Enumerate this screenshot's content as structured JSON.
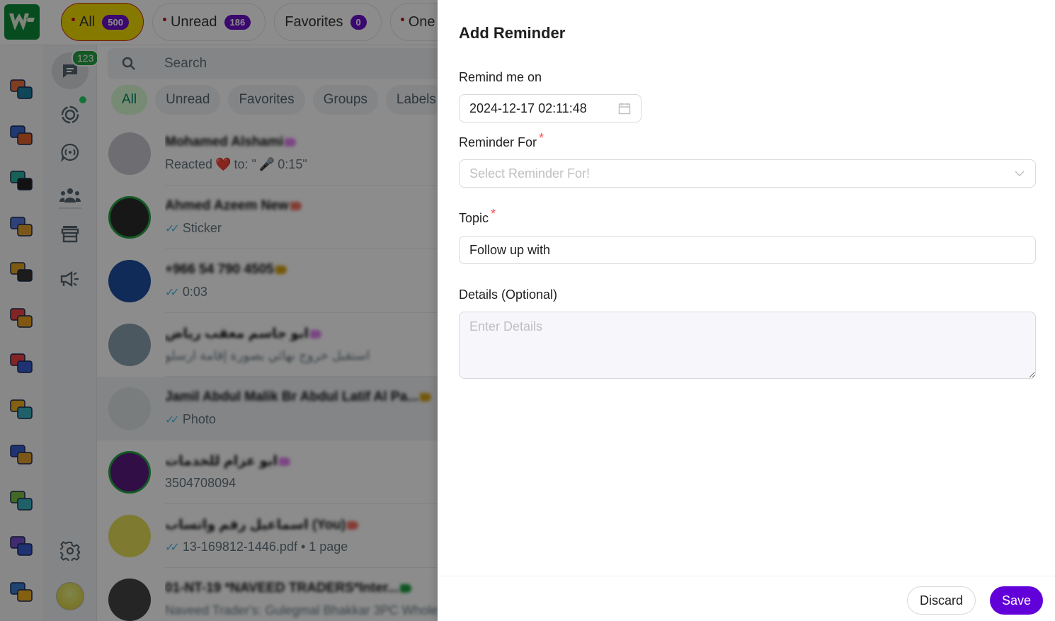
{
  "app": {
    "logo_text": "W",
    "top_tabs": [
      {
        "label": "All",
        "count": "500",
        "dot": true,
        "active": true
      },
      {
        "label": "Unread",
        "count": "186",
        "dot": true,
        "active": false
      },
      {
        "label": "Favorites",
        "count": "0",
        "dot": false,
        "active": false
      },
      {
        "label": "One to",
        "count": "",
        "dot": true,
        "active": false
      }
    ],
    "rail1_icons": [
      "chat-bubbles-icon",
      "templates-icon",
      "multi-chat-icon",
      "chatbot-icon",
      "board-icon",
      "notification-chat-icon",
      "todo-icon",
      "reminder-bell-icon",
      "schedule-table-icon",
      "widget-touch-icon",
      "settings-tool-icon",
      "support-agent-icon"
    ],
    "rail2": {
      "chats_badge": "123",
      "icons": [
        "chats-icon",
        "status-icon",
        "channels-icon",
        "communities-icon",
        "store-icon",
        "broadcast-icon",
        "settings-icon"
      ]
    },
    "search": {
      "placeholder": "Search"
    },
    "filter_chips": [
      "All",
      "Unread",
      "Favorites",
      "Groups",
      "Labels"
    ],
    "chats": [
      {
        "name": "Mohamed Alshami",
        "preview_parts": [
          "Reacted",
          "❤️",
          "to: \"",
          "🎤",
          "0:15\""
        ],
        "tag_color": "#e07ef0",
        "ring": false,
        "ticks": false
      },
      {
        "name": "Ahmed Azeem New",
        "preview": "Sticker",
        "tag_color": "#f07060",
        "ring": true,
        "ticks": true
      },
      {
        "name": "+966 54 790 4505",
        "preview": "0:03",
        "tag_color": "#d4a010",
        "ring": false,
        "ticks": true
      },
      {
        "name": "ابو جاسم معقب رياض",
        "preview": "استقبل خروج نهائي بصورة إقامة ارسلو",
        "tag_color": "#e07ef0",
        "ring": false,
        "ticks": false
      },
      {
        "name": "Jamil Abdul Malik Br Abdul Latif Al Pa...",
        "preview": "Photo",
        "tag_color": "#d4a010",
        "ring": false,
        "ticks": true,
        "selected": true
      },
      {
        "name": "ابو عزام للخدمات",
        "preview": "3504708094",
        "tag_color": "#e07ef0",
        "ring": true,
        "ticks": false
      },
      {
        "name": "اسماعيل رقم واتساب (You)",
        "preview": "13-169812-1446.pdf • 1 page",
        "tag_color": "#f07060",
        "ring": false,
        "ticks": true
      },
      {
        "name": "01-NT-19 *NAVEED TRADERS*Inter...",
        "preview": "Naveed Trader's: Gulegmal Bhakkar 3PC Whole",
        "tag_color": "#1a9a3a",
        "ring": false,
        "ticks": false
      }
    ]
  },
  "drawer": {
    "title": "Add Reminder",
    "remind_on": {
      "label": "Remind me on",
      "value": "2024-12-17 02:11:48"
    },
    "reminder_for": {
      "label": "Reminder For",
      "required_mark": "*",
      "placeholder": "Select Reminder For!"
    },
    "topic": {
      "label": "Topic",
      "required_mark": "*",
      "value": "Follow up with"
    },
    "details": {
      "label": "Details (Optional)",
      "placeholder": "Enter Details"
    },
    "buttons": {
      "discard": "Discard",
      "save": "Save"
    }
  },
  "colors": {
    "primary": "#6200d9",
    "required": "#ff4d4f",
    "whatsapp_green": "#25a244"
  }
}
